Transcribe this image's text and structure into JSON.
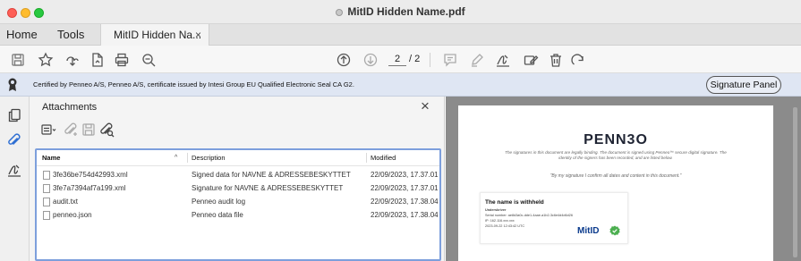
{
  "window": {
    "title": "MitID Hidden Name.pdf"
  },
  "nav": {
    "home": "Home",
    "tools": "Tools",
    "doc_tab": "MitID Hidden Na...",
    "doc_tab_close": "×"
  },
  "toolbar": {
    "page_current": "2",
    "page_total": "/ 2",
    "icons": [
      "save-icon",
      "bookmark-star-icon",
      "share-icon",
      "export-pdf-icon",
      "print-icon",
      "zoom-icon",
      "page-up-icon",
      "page-down-icon",
      "comment-icon",
      "highlight-pen-icon",
      "sign-icon",
      "fill-sign-icon",
      "delete-icon",
      "rotate-icon"
    ]
  },
  "signature_bar": {
    "text": "Certified by Penneo A/S, Penneo A/S, certificate issued by Intesi Group EU Qualified Electronic Seal CA G2.",
    "panel_button": "Signature Panel",
    "bg_color": "#dfe6f3"
  },
  "sidebar": {
    "icons": [
      "pages-icon",
      "attachments-icon",
      "signatures-icon"
    ]
  },
  "attachments": {
    "title": "Attachments",
    "close": "×",
    "columns": {
      "name": "Name",
      "sort": "^",
      "description": "Description",
      "modified": "Modified"
    },
    "files": [
      {
        "name": "3fe36be754d42993.xml",
        "description": "Signed data for NAVNE & ADRESSEBESKYTTET",
        "modified": "22/09/2023, 17.37.01"
      },
      {
        "name": "3fe7a7394af7a199.xml",
        "description": "Signature for NAVNE & ADRESSEBESKYTTET",
        "modified": "22/09/2023, 17.37.01"
      },
      {
        "name": "audit.txt",
        "description": "Penneo audit log",
        "modified": "22/09/2023, 17.38.04"
      },
      {
        "name": "penneo.json",
        "description": "Penneo data file",
        "modified": "22/09/2023, 17.38.04"
      }
    ],
    "accent_color": "#7d9fdc"
  },
  "document": {
    "logo": "PENN3O",
    "intro_line1": "The signatures in this document are legally binding. The document is signed using Penneo™ secure digital signature. The",
    "intro_line2": "identity of the signers has been recorded, and are listed below.",
    "quote": "\"By my signature I confirm all dates and content in this document.\"",
    "card": {
      "title": "The name is withheld",
      "line1": "Underskriver",
      "line2": "Serial number: ae8d3a0c-dde1-4aae-a1b2-3c6e4d4d6d26",
      "line3": "IP: 162.116.xxx.xxx",
      "line4": "2023-09-22 12:43:42 UTC",
      "badge": "MitID"
    }
  }
}
